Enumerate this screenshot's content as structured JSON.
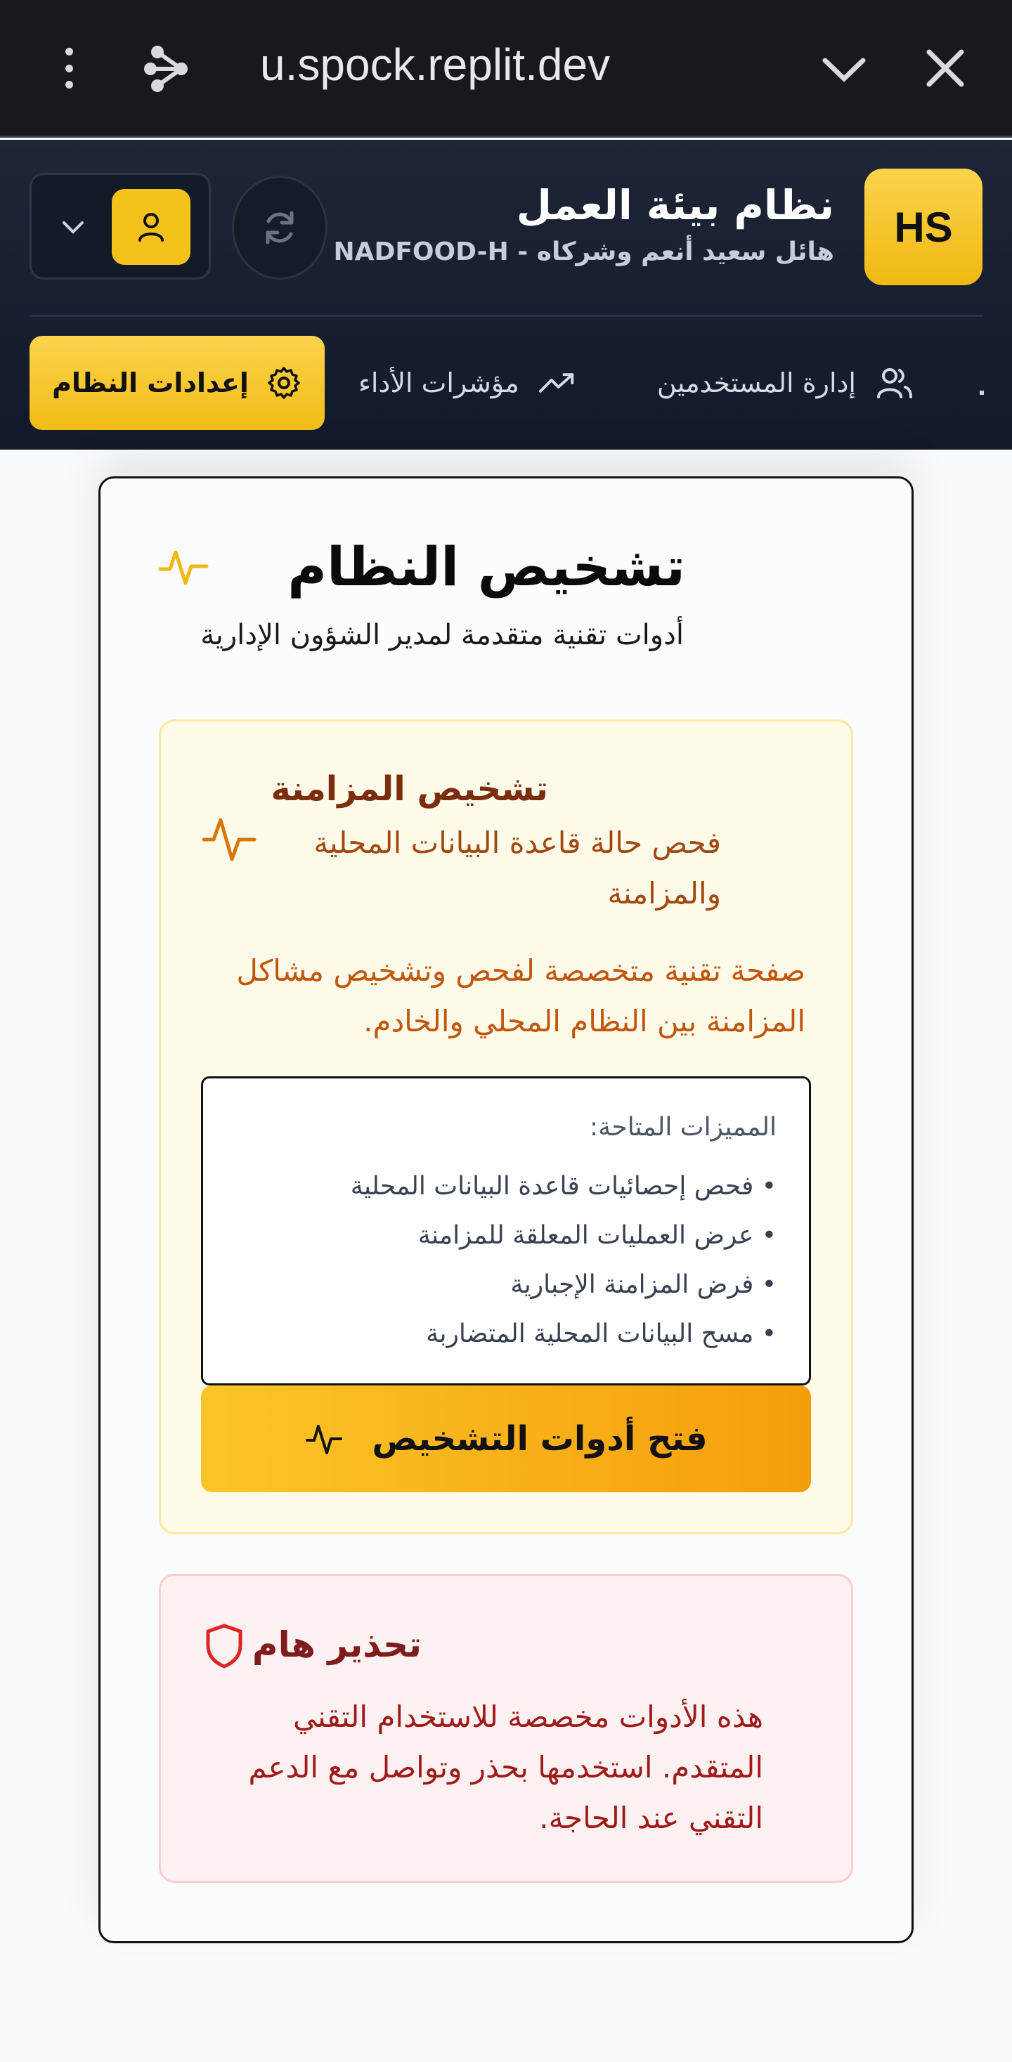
{
  "browser": {
    "url": "u.spock.replit.dev",
    "icons": [
      "more-vert-icon",
      "share-icon",
      "chevron-down-icon",
      "close-icon"
    ]
  },
  "header": {
    "badge": "HS",
    "title": "نظام بيئة العمل",
    "subtitle": "NADFOOD-H - هائل سعيد أنعم وشركاه",
    "icons": [
      "refresh-icon",
      "user-icon",
      "chevron-down-icon"
    ]
  },
  "nav": {
    "settings_label": "إعدادات النظام",
    "performance_label": "مؤشرات الأداء",
    "users_label": "إدارة المستخدمين"
  },
  "page": {
    "title": "تشخيص النظام",
    "subtitle": "أدوات تقنية متقدمة لمدير الشؤون الإدارية"
  },
  "sync_card": {
    "title": "تشخيص المزامنة",
    "description": "فحص حالة قاعدة البيانات المحلية والمزامنة",
    "long_description": "صفحة تقنية متخصصة لفحص وتشخيص مشاكل المزامنة بين النظام المحلي والخادم.",
    "features_heading": "المميزات المتاحة:",
    "features": [
      "• فحص إحصائيات قاعدة البيانات المحلية",
      "• عرض العمليات المعلقة للمزامنة",
      "• فرض المزامنة الإجبارية",
      "• مسح البيانات المحلية المتضاربة"
    ],
    "button_label": "فتح أدوات التشخيص"
  },
  "warning": {
    "title": "تحذير هام",
    "text": "هذه الأدوات مخصصة للاستخدام التقني المتقدم. استخدمها بحذر وتواصل مع الدعم التقني عند الحاجة."
  },
  "colors": {
    "accent": "#f4c21a",
    "header_bg": "#1a2233",
    "warning": "#b91c1c",
    "sync_text": "#c2560a"
  }
}
